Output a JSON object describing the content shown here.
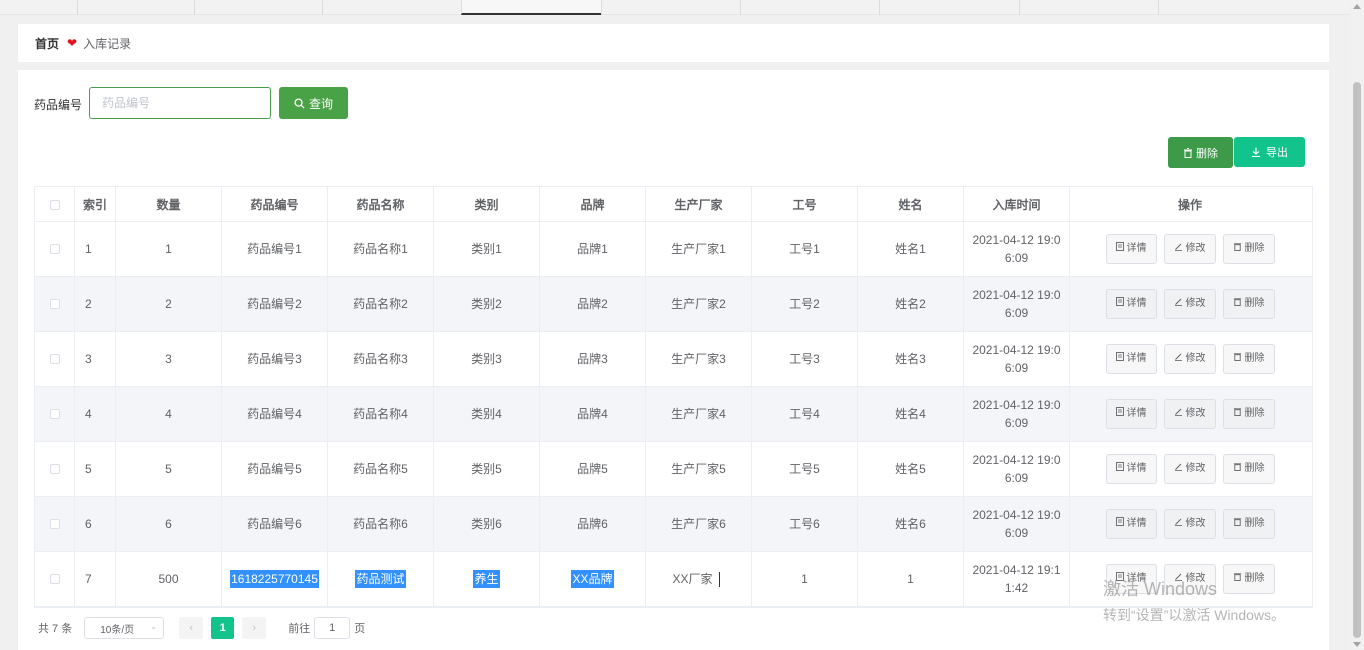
{
  "breadcrumb": {
    "home": "首页",
    "current": "入库记录"
  },
  "search": {
    "label": "药品编号",
    "placeholder": "药品编号",
    "query_label": "查询"
  },
  "actions": {
    "delete_label": "删除",
    "export_label": "导出"
  },
  "table": {
    "columns": [
      "索引",
      "数量",
      "药品编号",
      "药品名称",
      "类别",
      "品牌",
      "生产厂家",
      "工号",
      "姓名",
      "入库时间",
      "操作"
    ],
    "op_labels": {
      "detail": "详情",
      "edit": "修改",
      "delete": "删除"
    },
    "rows": [
      {
        "index": "1",
        "qty": "1",
        "code": "药品编号1",
        "name": "药品名称1",
        "category": "类别1",
        "brand": "品牌1",
        "maker": "生产厂家1",
        "job_no": "工号1",
        "person": "姓名1",
        "time_a": "2021-04-12 19:0",
        "time_b": "6:09"
      },
      {
        "index": "2",
        "qty": "2",
        "code": "药品编号2",
        "name": "药品名称2",
        "category": "类别2",
        "brand": "品牌2",
        "maker": "生产厂家2",
        "job_no": "工号2",
        "person": "姓名2",
        "time_a": "2021-04-12 19:0",
        "time_b": "6:09"
      },
      {
        "index": "3",
        "qty": "3",
        "code": "药品编号3",
        "name": "药品名称3",
        "category": "类别3",
        "brand": "品牌3",
        "maker": "生产厂家3",
        "job_no": "工号3",
        "person": "姓名3",
        "time_a": "2021-04-12 19:0",
        "time_b": "6:09"
      },
      {
        "index": "4",
        "qty": "4",
        "code": "药品编号4",
        "name": "药品名称4",
        "category": "类别4",
        "brand": "品牌4",
        "maker": "生产厂家4",
        "job_no": "工号4",
        "person": "姓名4",
        "time_a": "2021-04-12 19:0",
        "time_b": "6:09"
      },
      {
        "index": "5",
        "qty": "5",
        "code": "药品编号5",
        "name": "药品名称5",
        "category": "类别5",
        "brand": "品牌5",
        "maker": "生产厂家5",
        "job_no": "工号5",
        "person": "姓名5",
        "time_a": "2021-04-12 19:0",
        "time_b": "6:09"
      },
      {
        "index": "6",
        "qty": "6",
        "code": "药品编号6",
        "name": "药品名称6",
        "category": "类别6",
        "brand": "品牌6",
        "maker": "生产厂家6",
        "job_no": "工号6",
        "person": "姓名6",
        "time_a": "2021-04-12 19:0",
        "time_b": "6:09"
      },
      {
        "index": "7",
        "qty": "500",
        "code": "1618225770145",
        "name": "药品测试",
        "category": "养生",
        "brand": "XX品牌",
        "maker": "XX厂家",
        "job_no": "1",
        "person": "1",
        "time_a": "2021-04-12 19:1",
        "time_b": "1:42"
      }
    ]
  },
  "pagination": {
    "total": "共 7 条",
    "page_size": "10条/页",
    "current_page": "1",
    "goto_prefix": "前往",
    "goto_value": "1",
    "goto_suffix": "页"
  },
  "watermark": {
    "line1": "激活 Windows",
    "line2": "转到“设置”以激活 Windows。"
  },
  "colors": {
    "primary_green": "#4aa247",
    "teal": "#13c38c",
    "selection": "#3390ff",
    "heart": "#e4121d"
  },
  "icons": [
    "heart-icon",
    "search-icon",
    "trash-icon",
    "download-icon",
    "document-icon",
    "edit-icon",
    "chevron-left-icon",
    "chevron-right-icon",
    "chevron-down-icon"
  ]
}
